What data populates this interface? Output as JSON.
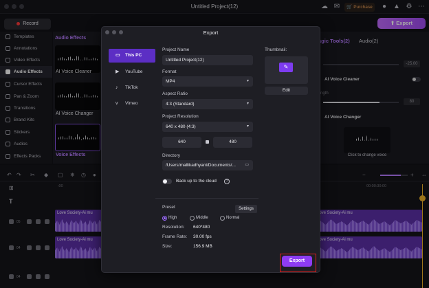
{
  "app": {
    "title": "Untitled Project(12)",
    "purchase_label": "Purchase",
    "record_label": "Record",
    "export_label": "Export",
    "accent": "#9d6bff"
  },
  "sidebar": {
    "items": [
      {
        "label": "Templates",
        "icon": "templates-icon"
      },
      {
        "label": "Annotations",
        "icon": "annotations-icon"
      },
      {
        "label": "Video Effects",
        "icon": "video-effects-icon"
      },
      {
        "label": "Audio Effects",
        "icon": "audio-effects-icon",
        "active": true
      },
      {
        "label": "Cursor Effects",
        "icon": "cursor-icon"
      },
      {
        "label": "Pan & Zoom",
        "icon": "pan-zoom-icon"
      },
      {
        "label": "Transitions",
        "icon": "transitions-icon"
      },
      {
        "label": "Brand Kits",
        "icon": "brand-kit-icon"
      },
      {
        "label": "Stickers",
        "icon": "stickers-icon"
      },
      {
        "label": "Audios",
        "icon": "audios-icon"
      },
      {
        "label": "Effects Packs",
        "icon": "effects-packs-icon"
      }
    ]
  },
  "media": {
    "tab_label": "Audio Effects",
    "cards": [
      {
        "label": "AI Voice Cleaner"
      },
      {
        "label": "AI Voice Changer"
      }
    ],
    "section_label": "Voice Effects"
  },
  "rightpanel": {
    "tabs": [
      "agic Tools(2)",
      "Audio(2)"
    ],
    "value_top": "-25.00",
    "value_mid": "80",
    "label_partial": "ngth",
    "voice_cleaner_label": "AI Voice Cleaner",
    "voice_changer_label": "AI Voice Changer",
    "change_voice_text": "Click to change voice"
  },
  "timeline": {
    "ruler_start": ":00",
    "ruler_end": "00:00:30:00",
    "tracks": [
      {
        "number": "05",
        "clip_title": "Love Society-Ai mu"
      },
      {
        "number": "04",
        "clip_title": "Love Society-Ai mu"
      },
      {
        "number": "04"
      }
    ],
    "clip_title_right": "Love Society-Ai mu"
  },
  "dialog": {
    "title": "Export",
    "destinations": [
      {
        "label": "This PC",
        "active": true,
        "icon": "computer-icon"
      },
      {
        "label": "YouTube",
        "icon": "youtube-icon"
      },
      {
        "label": "TikTok",
        "icon": "tiktok-icon"
      },
      {
        "label": "Vimeo",
        "icon": "vimeo-icon"
      }
    ],
    "project_name_label": "Project Name",
    "project_name_value": "Untitled Project(12)",
    "format_label": "Format",
    "format_value": "MP4",
    "aspect_label": "Aspect Ratio",
    "aspect_value": "4:3 (Standard)",
    "resolution_label": "Project Resolution",
    "resolution_value": "640 x 480 (4:3)",
    "width_value": "640",
    "height_value": "480",
    "directory_label": "Directory",
    "directory_value": "/Users/mallikadhyani/Documents/...",
    "cloud_label": "Back up to the cloud",
    "thumbnail_label": "Thumbnail:",
    "edit_label": "Edit",
    "preset_label": "Preset",
    "settings_label": "Settings",
    "quality_options": [
      {
        "label": "High",
        "selected": true
      },
      {
        "label": "Middle"
      },
      {
        "label": "Normal"
      }
    ],
    "details": [
      {
        "key": "Resolution:",
        "value": "640*480"
      },
      {
        "key": "Frame Rate:",
        "value": "30.00 fps"
      },
      {
        "key": "Size:",
        "value": "156.9 MB"
      }
    ],
    "export_label": "Export"
  }
}
